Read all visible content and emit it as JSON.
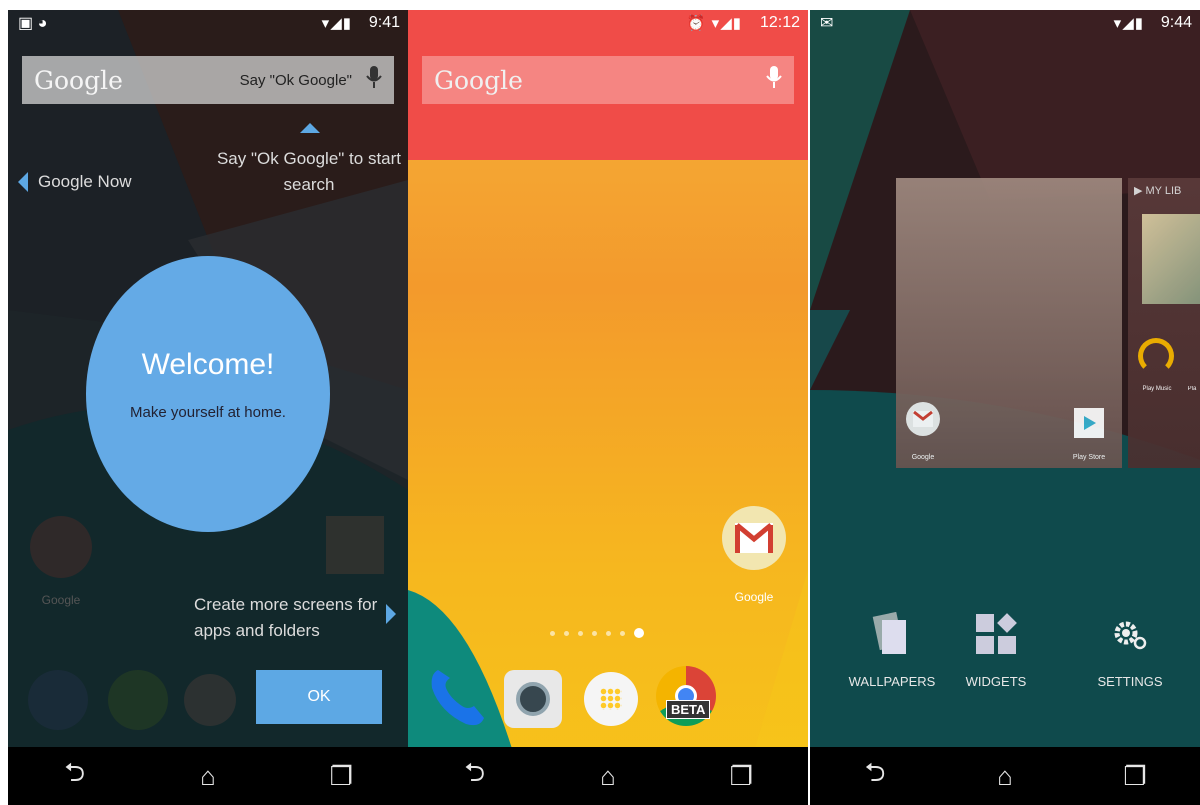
{
  "screen1": {
    "status_time": "9:41",
    "search_logo": "Google",
    "search_hint": "Say \"Ok Google\"",
    "tip_ok_google": "Say \"Ok Google\" to start search",
    "google_now_label": "Google Now",
    "welcome_title": "Welcome!",
    "welcome_body": "Make yourself at home.",
    "tip_screens": "Create more screens for apps and folders",
    "ok_button": "OK",
    "dim_app_label": "Google",
    "accent": "#5da8e4"
  },
  "screen2": {
    "status_time": "12:12",
    "search_logo": "Google",
    "gmail_label": "Google",
    "chrome_badge": "BETA",
    "page_dots": 7,
    "active_dot": 7
  },
  "screen3": {
    "status_time": "9:44",
    "folder_label_google": "Google",
    "playstore_label": "Play Store",
    "mylib_label": "MY LIB",
    "playmusic_label": "Play Music",
    "play_cut_label": "Pla",
    "menu": [
      {
        "label": "WALLPAPERS",
        "icon": "wallpapers-icon"
      },
      {
        "label": "WIDGETS",
        "icon": "widgets-icon"
      },
      {
        "label": "SETTINGS",
        "icon": "settings-icon"
      }
    ]
  },
  "nav_icons": [
    "back-icon",
    "home-icon",
    "recents-icon"
  ]
}
